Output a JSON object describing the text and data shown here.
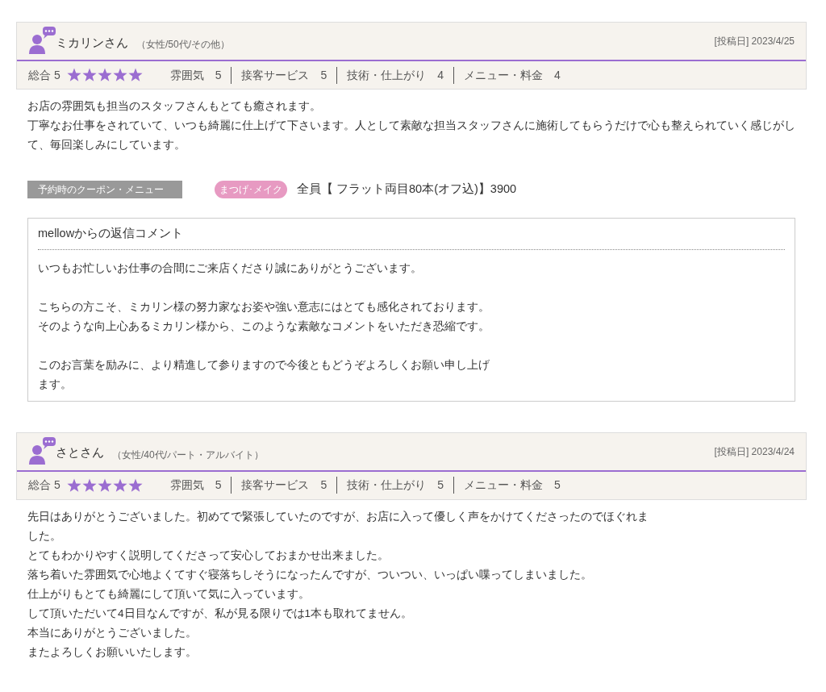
{
  "reviews": [
    {
      "name": "ミカリンさん",
      "profile": "（女性/50代/その他）",
      "date": "[投稿日] 2023/4/25",
      "overall_label": "総合",
      "overall_value": "5",
      "stars": 5,
      "ratings": [
        {
          "label": "雰囲気",
          "value": "5"
        },
        {
          "label": "接客サービス",
          "value": "5"
        },
        {
          "label": "技術・仕上がり",
          "value": "4"
        },
        {
          "label": "メニュー・料金",
          "value": "4"
        }
      ],
      "body": [
        "お店の雰囲気も担当のスタッフさんもとても癒されます。",
        "丁寧なお仕事をされていて、いつも綺麗に仕上げて下さいます。人として素敵な担当スタッフさんに施術してもらうだけで心も整えられていく感じがして、毎回楽しみにしています。"
      ],
      "coupon": {
        "label": "予約時のクーポン・メニュー",
        "tag": "まつげ･メイク",
        "text": "全員【 フラット両目80本(オフ込)】3900"
      },
      "reply": {
        "title": "mellowからの返信コメント",
        "body": [
          "いつもお忙しいお仕事の合間にご来店くださり誠にありがとうございます。",
          "こちらの方こそ、ミカリン様の努力家なお姿や強い意志にはとても感化されております。そのような向上心あるミカリン様から、このような素敵なコメントをいただき恐縮です。",
          "このお言葉を励みに、より精進して参りますので今後ともどうぞよろしくお願い申し上げます。"
        ]
      }
    },
    {
      "name": "さとさん",
      "profile": "（女性/40代/パート・アルバイト）",
      "date": "[投稿日] 2023/4/24",
      "overall_label": "総合",
      "overall_value": "5",
      "stars": 5,
      "ratings": [
        {
          "label": "雰囲気",
          "value": "5"
        },
        {
          "label": "接客サービス",
          "value": "5"
        },
        {
          "label": "技術・仕上がり",
          "value": "5"
        },
        {
          "label": "メニュー・料金",
          "value": "5"
        }
      ],
      "body": [
        "先日はありがとうございました。初めてで緊張していたのですが、お店に入って優しく声をかけてくださったのでほぐれました。",
        "とてもわかりやすく説明してくださって安心しておまかせ出来ました。",
        "落ち着いた雰囲気で心地よくてすぐ寝落ちしそうになったんですが、ついつい、いっぱい喋ってしまいました。",
        "仕上がりもとても綺麗にして頂いて気に入っています。",
        "して頂いただいて4日目なんですが、私が見る限りでは1本も取れてません。",
        "本当にありがとうございました。",
        "またよろしくお願いいたします。"
      ]
    }
  ]
}
